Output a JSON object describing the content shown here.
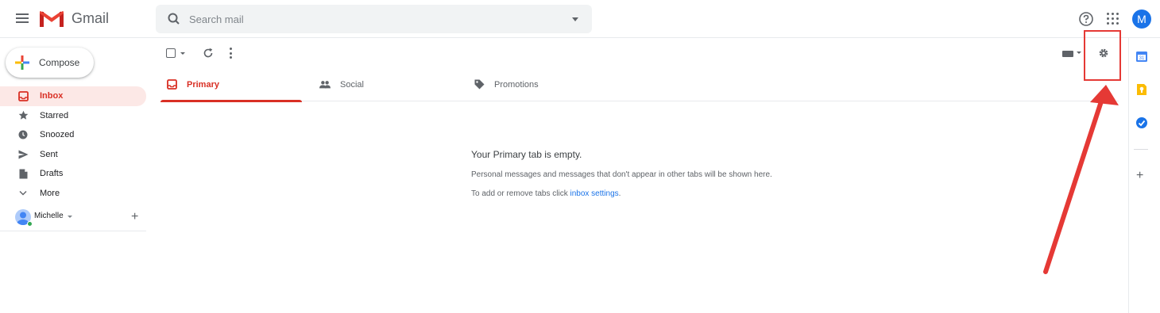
{
  "header": {
    "app_name": "Gmail",
    "search_placeholder": "Search mail",
    "account_initial": "M"
  },
  "sidebar": {
    "compose_label": "Compose",
    "items": [
      {
        "label": "Inbox",
        "icon": "inbox-icon",
        "active": true
      },
      {
        "label": "Starred",
        "icon": "star-icon"
      },
      {
        "label": "Snoozed",
        "icon": "clock-icon"
      },
      {
        "label": "Sent",
        "icon": "send-icon"
      },
      {
        "label": "Drafts",
        "icon": "draft-icon"
      },
      {
        "label": "More",
        "icon": "chevron-down-icon"
      }
    ],
    "account_name": "Michelle"
  },
  "tabs": [
    {
      "label": "Primary",
      "icon": "inbox-icon",
      "active": true
    },
    {
      "label": "Social",
      "icon": "people-icon"
    },
    {
      "label": "Promotions",
      "icon": "tag-icon"
    }
  ],
  "empty_state": {
    "title": "Your Primary tab is empty.",
    "description": "Personal messages and messages that don't appear in other tabs will be shown here.",
    "hint_prefix": "To add or remove tabs click ",
    "hint_link": "inbox settings",
    "hint_suffix": "."
  },
  "colors": {
    "accent_red": "#d93025",
    "active_bg": "#fce8e6",
    "link_blue": "#1a73e8",
    "annotation_red": "#e53935"
  },
  "side_panel": {
    "icons": [
      "calendar-icon",
      "keep-icon",
      "tasks-icon",
      "add-icon"
    ]
  }
}
